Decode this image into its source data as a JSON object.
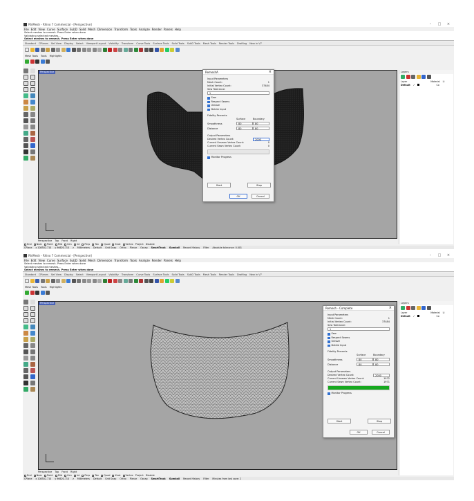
{
  "title": "RhiMesh - Rhino 7 Commercial - [Perspective]",
  "menu": [
    "File",
    "Edit",
    "View",
    "Curve",
    "Surface",
    "SubD",
    "Solid",
    "Mesh",
    "Dimension",
    "Transform",
    "Tools",
    "Analyze",
    "Render",
    "Panels",
    "Help"
  ],
  "command_history": [
    "Select meshes to remesh. Press Enter when done",
    "Validating selected meshes...",
    "Select meshes to remesh. Press Enter when done"
  ],
  "toolbar_tabs": [
    "Standard",
    "CPlanes",
    "Set View",
    "Display",
    "Select",
    "Viewport Layout",
    "Visibility",
    "Transform",
    "Curve Tools",
    "Surface Tools",
    "Solid Tools",
    "SubD Tools",
    "Mesh Tools",
    "Render Tools",
    "Drafting",
    "New in V7"
  ],
  "sub_tabs": [
    "Mesh Tools",
    "Tools",
    "Highlights"
  ],
  "viewport_label": "Perspective",
  "viewport_tabs": [
    "Perspective",
    "Top",
    "Front",
    "Right"
  ],
  "osnaps": [
    "End",
    "Near",
    "Point",
    "Mid",
    "Cen",
    "Int",
    "Perp",
    "Tan",
    "Quad",
    "Knot",
    "Vertex",
    "Project",
    "Disable"
  ],
  "status1": [
    "CPlane",
    "x 108502.710",
    "y 96620.710",
    "z",
    "Millimeters",
    "Default",
    "Grid Snap",
    "Ortho",
    "Planar",
    "Osnap",
    "SmartTrack",
    "Gumball",
    "Record History",
    "Filter",
    "Absolute tolerance: 0.001"
  ],
  "status2": [
    "CPlane",
    "x 108502.710",
    "y 96620.710",
    "z",
    "Millimeters",
    "Default",
    "Grid Snap",
    "Ortho",
    "Planar",
    "Osnap",
    "SmartTrack",
    "Gumball",
    "Record History",
    "Filter",
    "Minutes from last save: 2"
  ],
  "layers": {
    "title": "Layers",
    "columns": [
      "Layer",
      "Material",
      "Li"
    ],
    "row": {
      "name": "Default",
      "check": "✓",
      "extra": "Co"
    }
  },
  "dialog1": {
    "title": "RemeshA",
    "input_params": "Input Parameters",
    "mesh_count_label": "Mesh Count:",
    "mesh_count": "1",
    "initial_vertex_label": "Initial Vertex Count:",
    "initial_vertex": "37484",
    "sew_tol_label": "Sew Tolerance:",
    "sew_tol": "1",
    "checks": [
      "Sew",
      "Respect Seams",
      "Unisize",
      "Delete Input"
    ],
    "fidelity": "Fidelity Percents",
    "col_surface": "Surface",
    "col_boundary": "Boundary",
    "smoothness_label": "Smoothness",
    "smoothness_surface": "80",
    "smoothness_boundary": "80",
    "distance_label": "Distance",
    "distance_surface": "80",
    "distance_boundary": "80",
    "output_params": "Output Parameters",
    "desired_label": "Desired Vertex Count:",
    "desired": "2000",
    "unsewn_label": "Current Unsewn Vertex Count:",
    "unsewn": "0",
    "sewn_label": "Current Sewn Vertex Count:",
    "sewn": "0",
    "monitor": "Monitor Progress",
    "start": "Start",
    "stop": "Stop",
    "ok": "OK",
    "cancel": "Cancel"
  },
  "dialog2": {
    "title": "Remesh - Complete",
    "input_params": "Input Parameters",
    "mesh_count_label": "Mesh Count:",
    "mesh_count": "1",
    "initial_vertex_label": "Initial Vertex Count:",
    "initial_vertex": "37484",
    "sew_tol_label": "Sew Tolerance:",
    "sew_tol": "1",
    "checks": [
      "Sew",
      "Respect Seams",
      "Unisize",
      "Delete Input"
    ],
    "fidelity": "Fidelity Percents",
    "col_surface": "Surface",
    "col_boundary": "Boundary",
    "smoothness_label": "Smoothness",
    "smoothness_surface": "80",
    "smoothness_boundary": "80",
    "distance_label": "Distance",
    "distance_surface": "80",
    "distance_boundary": "80",
    "output_params": "Output Parameters",
    "desired_label": "Desired Vertex Count:",
    "desired": "2000",
    "unsewn_label": "Current Unsewn Vertex Count:",
    "unsewn": "1972",
    "sewn_label": "Current Sewn Vertex Count:",
    "sewn": "1971",
    "progress": 1.0,
    "monitor": "Monitor Progress",
    "start": "Start",
    "stop": "Stop",
    "ok": "OK",
    "cancel": "Cancel"
  },
  "colors": {
    "accent": "#3b6fd3",
    "viewport_bg": "#a5a5a5",
    "mesh_dark": "#1c1c1c",
    "mesh_light": "#bdbdbd",
    "progress": "#16a81e"
  }
}
